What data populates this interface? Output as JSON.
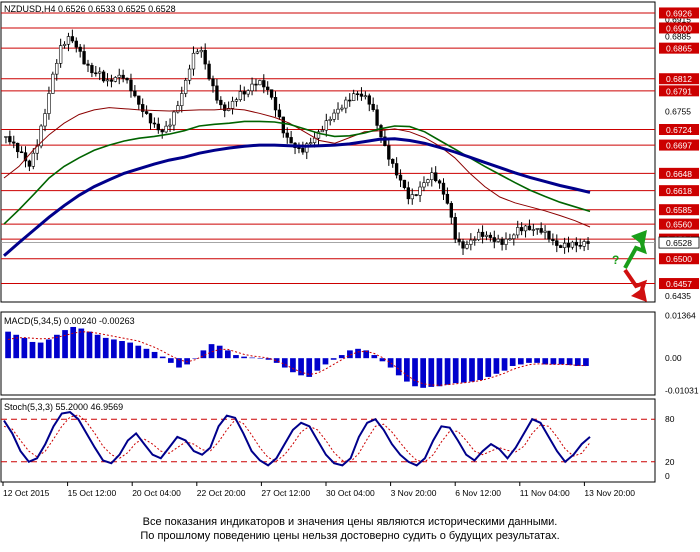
{
  "chart_data": [
    {
      "type": "candlestick",
      "header": {
        "symbol": "NZDUSD,H4",
        "ohlc": "0.6526 0.6533 0.6525 0.6528"
      },
      "ylim": [
        0.6425,
        0.6945
      ],
      "x_ticks": [
        "12 Oct 2015",
        "15 Oct 12:00",
        "20 Oct 04:00",
        "22 Oct 20:00",
        "27 Oct 12:00",
        "30 Oct 04:00",
        "3 Nov 20:00",
        "6 Nov 12:00",
        "11 Nov 04:00",
        "13 Nov 20:00"
      ],
      "y_labels_plain": [
        "0.6915",
        "0.6885",
        "0.6755",
        "0.6725",
        "0.6435"
      ],
      "levels": [
        {
          "value": 0.6926,
          "label": "0.6926"
        },
        {
          "value": 0.69,
          "label": "0.6900"
        },
        {
          "value": 0.6865,
          "label": "0.6865"
        },
        {
          "value": 0.6812,
          "label": "0.6812"
        },
        {
          "value": 0.6791,
          "label": "0.6791"
        },
        {
          "value": 0.6724,
          "label": "0.6724"
        },
        {
          "value": 0.6697,
          "label": "0.6697"
        },
        {
          "value": 0.6648,
          "label": "0.6648"
        },
        {
          "value": 0.6618,
          "label": "0.6618"
        },
        {
          "value": 0.6585,
          "label": "0.6585"
        },
        {
          "value": 0.656,
          "label": "0.6560"
        },
        {
          "value": 0.6534,
          "label": "0.6534"
        },
        {
          "value": 0.65,
          "label": "0.6500"
        },
        {
          "value": 0.6457,
          "label": "0.6457"
        }
      ],
      "current_price": {
        "value": 0.6528,
        "label": "0.6528"
      },
      "price_path": [
        0.6712,
        0.669,
        0.6672,
        0.6655,
        0.67,
        0.676,
        0.6825,
        0.6868,
        0.688,
        0.6862,
        0.6835,
        0.6822,
        0.6828,
        0.6815,
        0.682,
        0.6818,
        0.679,
        0.676,
        0.6745,
        0.6735,
        0.6728,
        0.674,
        0.6765,
        0.6795,
        0.684,
        0.686,
        0.682,
        0.679,
        0.6765,
        0.6772,
        0.6785,
        0.678,
        0.6796,
        0.68,
        0.679,
        0.676,
        0.672,
        0.67,
        0.668,
        0.669,
        0.6705,
        0.673,
        0.6755,
        0.677,
        0.678,
        0.6785,
        0.6775,
        0.676,
        0.672,
        0.669,
        0.6665,
        0.664,
        0.6605,
        0.661,
        0.6625,
        0.664,
        0.6625,
        0.66,
        0.654,
        0.6525,
        0.653,
        0.6535,
        0.653,
        0.6528,
        0.6532,
        0.6545,
        0.656,
        0.6555,
        0.6545,
        0.654,
        0.653,
        0.6522,
        0.653,
        0.6535,
        0.6528,
        0.6528
      ],
      "series": [
        {
          "color": "#8b0000",
          "values": [
            0.664,
            0.666,
            0.669,
            0.6715,
            0.6735,
            0.675,
            0.6758,
            0.6762,
            0.676,
            0.6758,
            0.6757,
            0.6756,
            0.6757,
            0.6758,
            0.6758,
            0.676,
            0.6758,
            0.6752,
            0.6745,
            0.6735,
            0.672,
            0.6705,
            0.67,
            0.671,
            0.672,
            0.6722,
            0.6725,
            0.672,
            0.671,
            0.6695,
            0.6675,
            0.6648,
            0.6625,
            0.6607,
            0.6597,
            0.659,
            0.6583,
            0.6575,
            0.6566,
            0.6555
          ]
        },
        {
          "color": "#006400",
          "values": [
            0.656,
            0.6585,
            0.6612,
            0.664,
            0.666,
            0.6675,
            0.6688,
            0.6697,
            0.6704,
            0.6709,
            0.6712,
            0.6716,
            0.6722,
            0.673,
            0.6733,
            0.6735,
            0.6738,
            0.6738,
            0.6737,
            0.6733,
            0.6725,
            0.6717,
            0.6712,
            0.6713,
            0.6718,
            0.6725,
            0.673,
            0.6729,
            0.672,
            0.6705,
            0.669,
            0.6675,
            0.666,
            0.6646,
            0.6632,
            0.6619,
            0.6608,
            0.6598,
            0.659,
            0.6582
          ]
        },
        {
          "color": "#00008b",
          "values": [
            0.6505,
            0.6528,
            0.655,
            0.6572,
            0.6592,
            0.661,
            0.6625,
            0.6637,
            0.6648,
            0.6656,
            0.6664,
            0.6671,
            0.6676,
            0.6683,
            0.6688,
            0.6692,
            0.6695,
            0.6697,
            0.6697,
            0.6696,
            0.6695,
            0.6696,
            0.6697,
            0.6699,
            0.6703,
            0.6707,
            0.6708,
            0.6705,
            0.67,
            0.6693,
            0.6685,
            0.6676,
            0.6667,
            0.6658,
            0.6649,
            0.6641,
            0.6634,
            0.6627,
            0.6621,
            0.6615
          ]
        }
      ],
      "forecast": {
        "question": "?"
      }
    },
    {
      "type": "bar",
      "title": "MACD(5,34,5) 0.00240 -0.00263",
      "ylim": [
        -0.0118,
        0.0148
      ],
      "y_labels": [
        {
          "value": 0.01364,
          "label": "0.01364"
        },
        {
          "value": 0.0,
          "label": "0.00"
        },
        {
          "value": -0.01031,
          "label": "-0.01031"
        }
      ],
      "values": [
        0.0085,
        0.0075,
        0.0065,
        0.0052,
        0.005,
        0.006,
        0.0075,
        0.009,
        0.01,
        0.0095,
        0.0085,
        0.0075,
        0.0065,
        0.006,
        0.0055,
        0.005,
        0.004,
        0.003,
        0.002,
        0.0005,
        -0.0015,
        -0.003,
        -0.002,
        0.0,
        0.0025,
        0.0045,
        0.004,
        0.0025,
        0.001,
        0.0005,
        0.0002,
        0.0,
        -0.0005,
        -0.0015,
        -0.003,
        -0.0045,
        -0.0055,
        -0.006,
        -0.004,
        -0.002,
        -0.0005,
        0.001,
        0.0025,
        0.003,
        0.0025,
        0.001,
        -0.001,
        -0.003,
        -0.0055,
        -0.0075,
        -0.009,
        -0.0095,
        -0.0092,
        -0.009,
        -0.0085,
        -0.008,
        -0.0078,
        -0.0075,
        -0.007,
        -0.006,
        -0.005,
        -0.004,
        -0.0025,
        -0.002,
        -0.0015,
        -0.0015,
        -0.002,
        -0.002,
        -0.002,
        -0.0022,
        -0.0025,
        -0.0025
      ],
      "signal": [
        0.006,
        0.0065,
        0.0066,
        0.0064,
        0.0062,
        0.0063,
        0.0067,
        0.0073,
        0.008,
        0.0085,
        0.0084,
        0.008,
        0.0075,
        0.007,
        0.0065,
        0.006,
        0.0055,
        0.0045,
        0.0035,
        0.0022,
        0.0008,
        -0.0005,
        -0.0012,
        -0.0005,
        0.0008,
        0.002,
        0.0028,
        0.0028,
        0.002,
        0.0012,
        0.0007,
        0.0004,
        0.0,
        -0.0008,
        -0.002,
        -0.0033,
        -0.0045,
        -0.0052,
        -0.0048,
        -0.0035,
        -0.002,
        -0.0005,
        0.001,
        0.002,
        0.0022,
        0.0015,
        0.0002,
        -0.0015,
        -0.0035,
        -0.0055,
        -0.0072,
        -0.0082,
        -0.0086,
        -0.0087,
        -0.0085,
        -0.0082,
        -0.0079,
        -0.0076,
        -0.0072,
        -0.0065,
        -0.0057,
        -0.0048,
        -0.0036,
        -0.0028,
        -0.0021,
        -0.0018,
        -0.0019,
        -0.002,
        -0.002,
        -0.0021,
        -0.0023,
        -0.0024
      ]
    },
    {
      "type": "line",
      "title": "Stoch(5,3,3) 55.2000 46.9569",
      "ylim": [
        0,
        100
      ],
      "y_labels": [
        {
          "value": 80,
          "label": "80"
        },
        {
          "value": 20,
          "label": "20"
        },
        {
          "value": 0,
          "label": "0"
        }
      ],
      "levels": [
        80,
        20
      ],
      "k": [
        78,
        60,
        35,
        20,
        25,
        45,
        70,
        88,
        90,
        80,
        60,
        40,
        22,
        18,
        30,
        50,
        60,
        45,
        30,
        25,
        40,
        55,
        50,
        35,
        30,
        40,
        70,
        85,
        82,
        60,
        35,
        22,
        15,
        25,
        45,
        65,
        75,
        70,
        50,
        30,
        18,
        15,
        25,
        55,
        75,
        80,
        65,
        45,
        30,
        20,
        15,
        25,
        50,
        70,
        68,
        50,
        30,
        22,
        35,
        45,
        38,
        25,
        40,
        60,
        80,
        75,
        55,
        35,
        20,
        30,
        45,
        55
      ],
      "d": [
        70,
        66,
        50,
        35,
        27,
        35,
        52,
        70,
        83,
        86,
        76,
        60,
        42,
        30,
        25,
        33,
        47,
        52,
        45,
        35,
        32,
        40,
        48,
        45,
        37,
        35,
        48,
        65,
        79,
        74,
        58,
        40,
        26,
        21,
        30,
        45,
        62,
        70,
        65,
        50,
        33,
        22,
        20,
        32,
        52,
        70,
        73,
        62,
        47,
        33,
        22,
        20,
        30,
        48,
        63,
        63,
        50,
        35,
        30,
        35,
        40,
        36,
        34,
        42,
        60,
        72,
        70,
        55,
        38,
        28,
        32,
        47
      ]
    }
  ],
  "disclaimer": {
    "line1": "Все показания индикаторов и значения цены являются историческими данными.",
    "line2": "По прошлому поведению цены нельзя достоверно судить о будущих результатах."
  }
}
